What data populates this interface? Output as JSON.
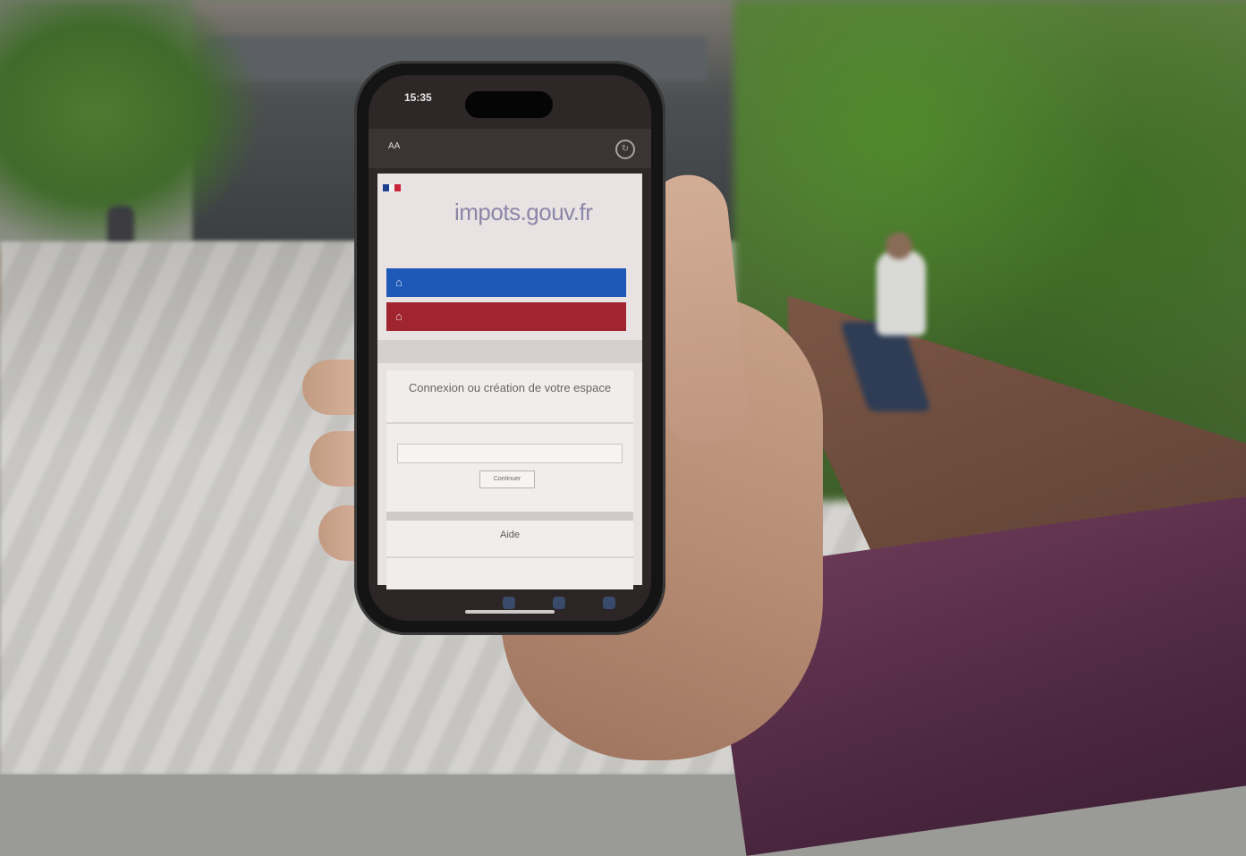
{
  "phone": {
    "status": {
      "time": "15:35",
      "sub_label": "",
      "icons": ""
    },
    "browser": {
      "aa": "AA",
      "url": "",
      "reload_icon": "reload-icon"
    },
    "site": {
      "brand": "impots.gouv.fr",
      "logo_lines": [
        "",
        "",
        ""
      ],
      "button_particulier": "",
      "button_professionnel": "",
      "breadcrumb": "",
      "login": {
        "title": "Connexion ou création de votre espace",
        "field_label": "",
        "field_placeholder": "",
        "continue_label": "Continuer"
      },
      "aide": "Aide",
      "help_item": ""
    }
  },
  "colors": {
    "particulier_blue": "#1f59b8",
    "professionnel_red": "#a12431",
    "brand_text": "#8a87a8"
  }
}
